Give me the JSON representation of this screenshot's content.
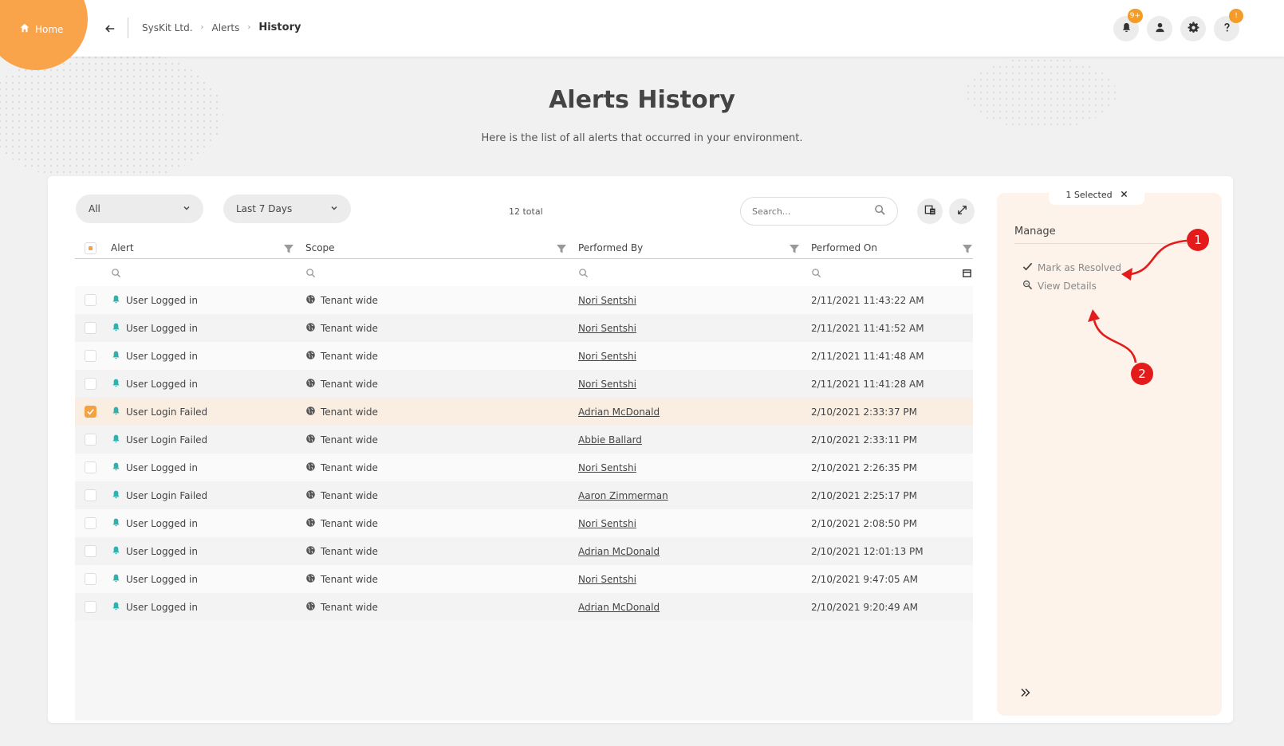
{
  "nav": {
    "home_label": "Home",
    "breadcrumb": [
      "SysKit Ltd.",
      "Alerts",
      "History"
    ],
    "notifications_badge": "9+",
    "help_badge": "!"
  },
  "header": {
    "title": "Alerts History",
    "subtitle": "Here is the list of all alerts that occurred in your environment."
  },
  "toolbar": {
    "filter_all": "All",
    "filter_range": "Last 7 Days",
    "total": "12 total",
    "search_placeholder": "Search..."
  },
  "grid": {
    "columns": [
      "Alert",
      "Scope",
      "Performed By",
      "Performed On"
    ],
    "rows": [
      {
        "alert": "User Logged in",
        "scope": "Tenant wide",
        "by": "Nori Sentshi",
        "on": "2/11/2021 11:43:22 AM",
        "selected": false
      },
      {
        "alert": "User Logged in",
        "scope": "Tenant wide",
        "by": "Nori Sentshi",
        "on": "2/11/2021 11:41:52 AM",
        "selected": false
      },
      {
        "alert": "User Logged in",
        "scope": "Tenant wide",
        "by": "Nori Sentshi",
        "on": "2/11/2021 11:41:48 AM",
        "selected": false
      },
      {
        "alert": "User Logged in",
        "scope": "Tenant wide",
        "by": "Nori Sentshi",
        "on": "2/11/2021 11:41:28 AM",
        "selected": false
      },
      {
        "alert": "User Login Failed",
        "scope": "Tenant wide",
        "by": "Adrian McDonald",
        "on": "2/10/2021 2:33:37 PM",
        "selected": true
      },
      {
        "alert": "User Login Failed",
        "scope": "Tenant wide",
        "by": "Abbie Ballard",
        "on": "2/10/2021 2:33:11 PM",
        "selected": false
      },
      {
        "alert": "User Logged in",
        "scope": "Tenant wide",
        "by": "Nori Sentshi",
        "on": "2/10/2021 2:26:35 PM",
        "selected": false
      },
      {
        "alert": "User Login Failed",
        "scope": "Tenant wide",
        "by": "Aaron Zimmerman",
        "on": "2/10/2021 2:25:17 PM",
        "selected": false
      },
      {
        "alert": "User Logged in",
        "scope": "Tenant wide",
        "by": "Nori Sentshi",
        "on": "2/10/2021 2:08:50 PM",
        "selected": false
      },
      {
        "alert": "User Logged in",
        "scope": "Tenant wide",
        "by": "Adrian McDonald",
        "on": "2/10/2021 12:01:13 PM",
        "selected": false
      },
      {
        "alert": "User Logged in",
        "scope": "Tenant wide",
        "by": "Nori Sentshi",
        "on": "2/10/2021 9:47:05 AM",
        "selected": false
      },
      {
        "alert": "User Logged in",
        "scope": "Tenant wide",
        "by": "Adrian McDonald",
        "on": "2/10/2021 9:20:49 AM",
        "selected": false
      }
    ]
  },
  "side_panel": {
    "selected_label": "1 Selected",
    "manage_label": "Manage",
    "actions": [
      "Mark as Resolved",
      "View Details"
    ]
  },
  "annotations": [
    "1",
    "2"
  ],
  "colors": {
    "accent": "#f9a34a",
    "marker": "#e41b1b",
    "alert_icon": "#2bb3b0"
  }
}
